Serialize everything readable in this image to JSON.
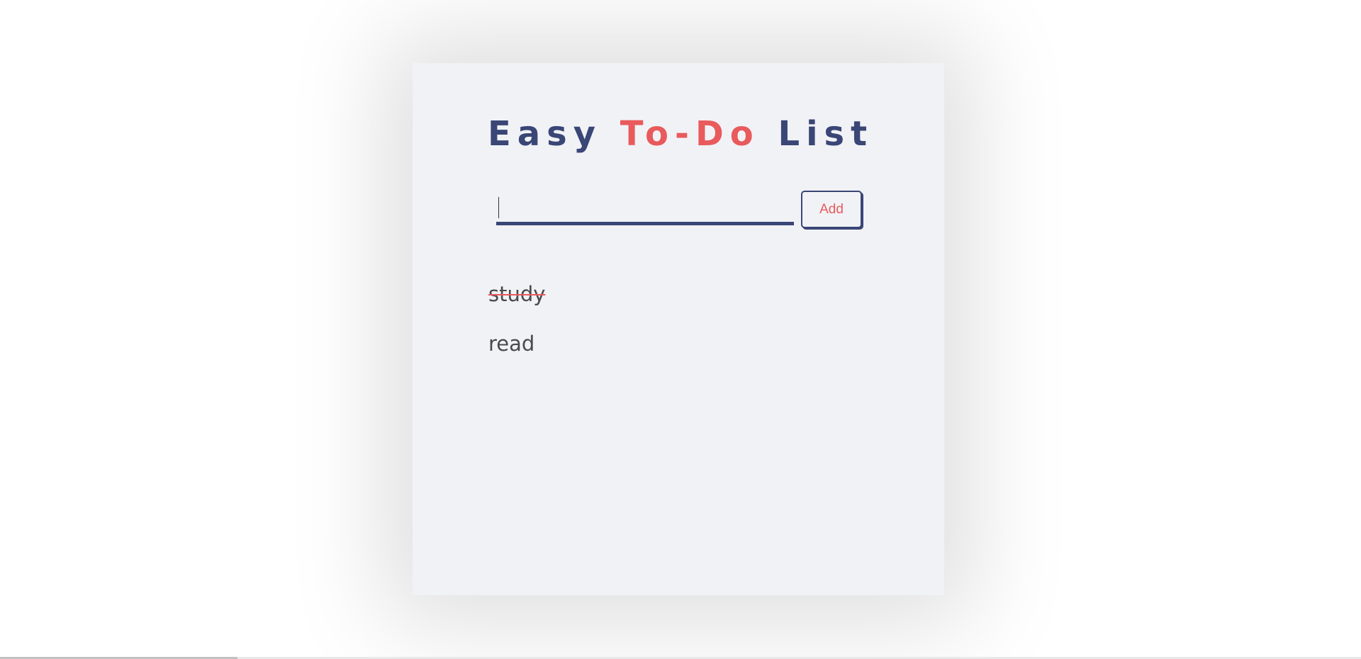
{
  "header": {
    "title_part1": "Easy ",
    "title_accent": "To-Do",
    "title_part3": " List"
  },
  "form": {
    "input_value": "",
    "add_label": "Add"
  },
  "todos": [
    {
      "text": "study",
      "completed": true
    },
    {
      "text": "read",
      "completed": false
    }
  ],
  "colors": {
    "primary": "#3a4676",
    "accent": "#e85a5c",
    "card_bg": "#f1f2f6"
  }
}
